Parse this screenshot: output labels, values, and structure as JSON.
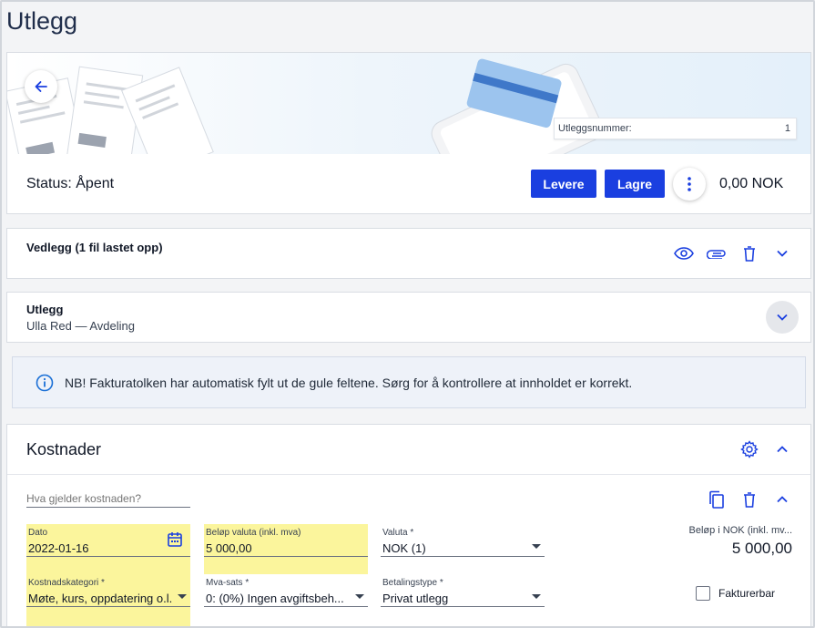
{
  "page": {
    "title": "Utlegg"
  },
  "hero": {
    "doc_number_label": "Utleggsnummer:",
    "doc_number_value": "1",
    "status": "Status: Åpent",
    "deliver_label": "Levere",
    "save_label": "Lagre",
    "total": "0,00 NOK"
  },
  "attachments": {
    "title": "Vedlegg (1 fil lastet opp)"
  },
  "expense": {
    "title": "Utlegg",
    "subtitle": "Ulla Red — Avdeling"
  },
  "notice": {
    "text": "NB! Fakturatolken har automatisk fylt ut de gule feltene. Sørg for å kontrollere at innholdet er korrekt."
  },
  "costs": {
    "title": "Kostnader",
    "description_placeholder": "Hva gjelder kostnaden?",
    "date_label": "Dato",
    "date_value": "2022-01-16",
    "amount_currency_label": "Beløp valuta (inkl. mva)",
    "amount_currency_value": "5 000,00",
    "currency_label": "Valuta *",
    "currency_value": "NOK (1)",
    "amount_nok_label": "Beløp i NOK (inkl. mv...",
    "amount_nok_value": "5 000,00",
    "category_label": "Kostnadskategori *",
    "category_value": "Møte, kurs, oppdatering o.l.",
    "vat_label": "Mva-sats *",
    "vat_value": "0: (0%) Ingen avgiftsbeh...",
    "payment_label": "Betalingstype *",
    "payment_value": "Privat utlegg",
    "billable_label": "Fakturerbar"
  },
  "colors": {
    "primary": "#1a3fe0",
    "highlight": "#fbf59c",
    "icon": "#1a3fe0"
  }
}
